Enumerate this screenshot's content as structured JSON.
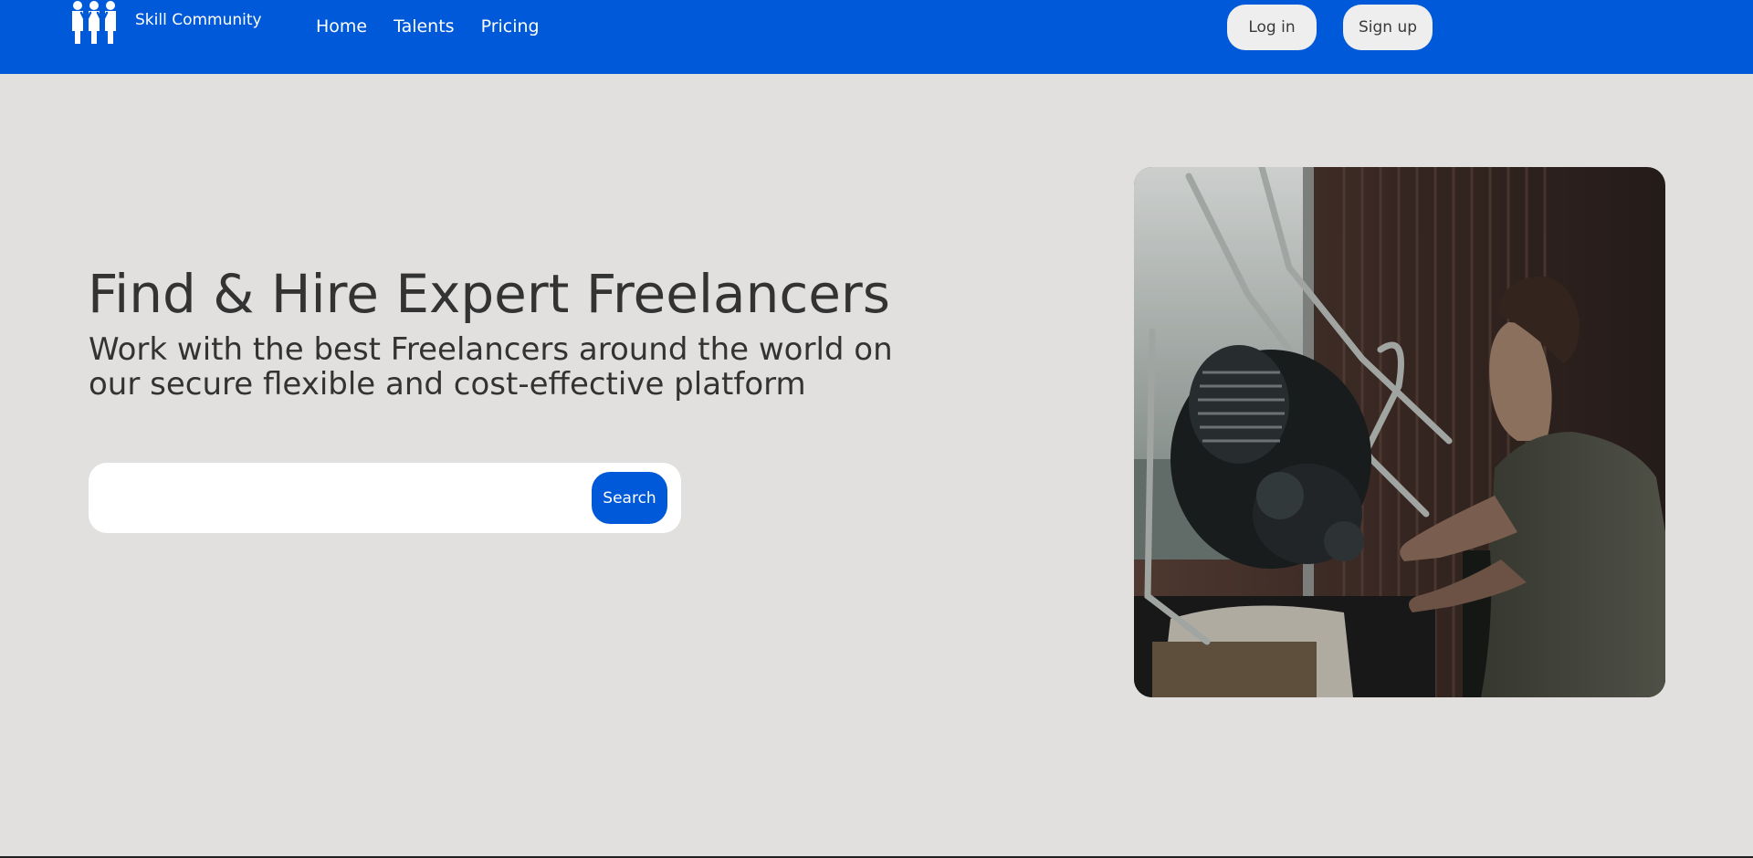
{
  "navbar": {
    "brand_name": "Skill Community",
    "links": [
      "Home",
      "Talents",
      "Pricing"
    ],
    "login_label": "Log in",
    "signup_label": "Sign up"
  },
  "hero": {
    "title": "Find & Hire Expert Freelancers",
    "subtitle": "Work with the best Freelancers around the world on our secure flexible and cost-effective platform"
  },
  "search": {
    "value": "",
    "placeholder": "",
    "button_label": "Search"
  },
  "colors": {
    "brand_blue": "#0059d8",
    "page_background": "#e1e0df",
    "text": "#333333",
    "button_light": "#efeeee"
  },
  "icons": {
    "logo": "three-people-logo-icon"
  }
}
